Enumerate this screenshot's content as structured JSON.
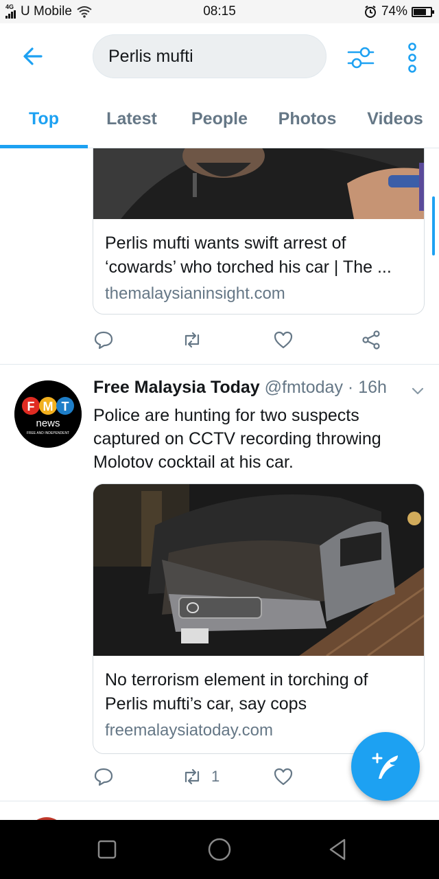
{
  "status_bar": {
    "network": "4G",
    "carrier": "U Mobile",
    "time": "08:15",
    "battery": "74%",
    "battery_level": 0.74
  },
  "header": {
    "search_text": "Perlis mufti",
    "back_icon": "arrow-left-icon",
    "filter_icon": "sliders-icon",
    "more_icon": "vertical-dots-icon"
  },
  "tabs": [
    {
      "label": "Top",
      "active": true
    },
    {
      "label": "Latest",
      "active": false
    },
    {
      "label": "People",
      "active": false
    },
    {
      "label": "Photos",
      "active": false
    },
    {
      "label": "Videos",
      "active": false
    }
  ],
  "tweets": [
    {
      "card": {
        "image_desc": "man in dark shirt with watch",
        "title": "Perlis mufti wants swift arrest of ‘cowards’ who torched his car | The ...",
        "domain": "themalaysianinsight.com"
      },
      "actions": {
        "reply": "",
        "retweet": "",
        "like": "",
        "share": ""
      }
    },
    {
      "author": {
        "name": "Free Malaysia Today",
        "handle": "@fmtoday",
        "time": "· 16h",
        "avatar_text": {
          "top": "FMT",
          "mid": "news",
          "bottom": "FREE AND INDEPENDENT"
        }
      },
      "text": "Police are hunting for two suspects captured on CCTV recording throwing Molotov cocktail at his car.",
      "card": {
        "image_desc": "burned car at night",
        "title": "No terrorism element in torching of Perlis mufti’s car, say cops",
        "domain": "freemalaysiatoday.com"
      },
      "actions": {
        "reply": "",
        "retweet": "1",
        "like": ""
      }
    }
  ],
  "colors": {
    "accent": "#1da1f2",
    "muted": "#657786",
    "text": "#14171a",
    "border": "#e1e8ed"
  }
}
